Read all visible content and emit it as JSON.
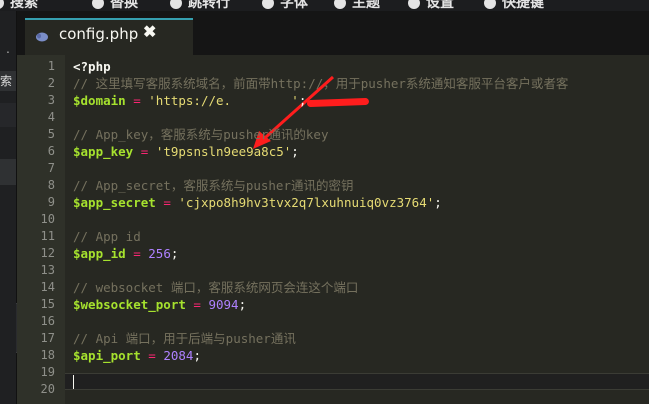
{
  "menubar": {
    "items": [
      {
        "label": "搜索",
        "icon": "search-icon"
      },
      {
        "label": "替换",
        "icon": "replace-icon"
      },
      {
        "label": "跳转行",
        "icon": "goto-icon"
      },
      {
        "label": "字体",
        "icon": "font-icon"
      },
      {
        "label": "主题",
        "icon": "theme-icon"
      },
      {
        "label": "设置",
        "icon": "gear-icon"
      },
      {
        "label": "快捷键",
        "icon": "keyboard-icon"
      }
    ]
  },
  "sidebar": {
    "search_label": "索",
    "collapse_glyph": "‹"
  },
  "tab": {
    "label": "config.php",
    "close": "✖",
    "icon": "php-elephant-icon"
  },
  "editor": {
    "lines": [
      {
        "n": "1",
        "tokens": [
          {
            "c": "tag",
            "t": "<?php"
          }
        ]
      },
      {
        "n": "2",
        "tokens": [
          {
            "c": "cmt",
            "t": "// 这里填写客服系统域名，前面带http://，用于pusher系统通知客服平台客户或者客"
          }
        ]
      },
      {
        "n": "3",
        "tokens": [
          {
            "c": "var",
            "t": "$domain"
          },
          {
            "c": "pun",
            "t": " "
          },
          {
            "c": "op",
            "t": "="
          },
          {
            "c": "pun",
            "t": " "
          },
          {
            "c": "str",
            "t": "'https://e."
          },
          {
            "c": "pun",
            "t": "        "
          },
          {
            "c": "str",
            "t": "'"
          },
          {
            "c": "pun",
            "t": ";"
          }
        ]
      },
      {
        "n": "4",
        "tokens": []
      },
      {
        "n": "5",
        "tokens": [
          {
            "c": "cmt",
            "t": "// App_key，客服系统与pusher通讯的key"
          }
        ]
      },
      {
        "n": "6",
        "tokens": [
          {
            "c": "var",
            "t": "$app_key"
          },
          {
            "c": "pun",
            "t": " "
          },
          {
            "c": "op",
            "t": "="
          },
          {
            "c": "pun",
            "t": " "
          },
          {
            "c": "str",
            "t": "'t9psnsln9ee9a8c5'"
          },
          {
            "c": "pun",
            "t": ";"
          }
        ]
      },
      {
        "n": "7",
        "tokens": []
      },
      {
        "n": "8",
        "tokens": [
          {
            "c": "cmt",
            "t": "// App_secret，客服系统与pusher通讯的密钥"
          }
        ]
      },
      {
        "n": "9",
        "tokens": [
          {
            "c": "var",
            "t": "$app_secret"
          },
          {
            "c": "pun",
            "t": " "
          },
          {
            "c": "op",
            "t": "="
          },
          {
            "c": "pun",
            "t": " "
          },
          {
            "c": "str",
            "t": "'cjxpo8h9hv3tvx2q7lxuhnuiq0vz3764'"
          },
          {
            "c": "pun",
            "t": ";"
          }
        ]
      },
      {
        "n": "10",
        "tokens": []
      },
      {
        "n": "11",
        "tokens": [
          {
            "c": "cmt",
            "t": "// App id"
          }
        ]
      },
      {
        "n": "12",
        "tokens": [
          {
            "c": "var",
            "t": "$app_id"
          },
          {
            "c": "pun",
            "t": " "
          },
          {
            "c": "op",
            "t": "="
          },
          {
            "c": "pun",
            "t": " "
          },
          {
            "c": "num",
            "t": "256"
          },
          {
            "c": "pun",
            "t": ";"
          }
        ]
      },
      {
        "n": "13",
        "tokens": []
      },
      {
        "n": "14",
        "tokens": [
          {
            "c": "cmt",
            "t": "// websocket 端口，客服系统网页会连这个端口"
          }
        ]
      },
      {
        "n": "15",
        "tokens": [
          {
            "c": "var",
            "t": "$websocket_port"
          },
          {
            "c": "pun",
            "t": " "
          },
          {
            "c": "op",
            "t": "="
          },
          {
            "c": "pun",
            "t": " "
          },
          {
            "c": "num",
            "t": "9094"
          },
          {
            "c": "pun",
            "t": ";"
          }
        ]
      },
      {
        "n": "16",
        "tokens": []
      },
      {
        "n": "17",
        "tokens": [
          {
            "c": "cmt",
            "t": "// Api 端口，用于后端与pusher通讯"
          }
        ]
      },
      {
        "n": "18",
        "tokens": [
          {
            "c": "var",
            "t": "$api_port"
          },
          {
            "c": "pun",
            "t": " "
          },
          {
            "c": "op",
            "t": "="
          },
          {
            "c": "pun",
            "t": " "
          },
          {
            "c": "num",
            "t": "2084"
          },
          {
            "c": "pun",
            "t": ";"
          }
        ]
      },
      {
        "n": "19",
        "tokens": []
      },
      {
        "n": "20",
        "tokens": []
      }
    ],
    "active_line": "20"
  },
  "colors": {
    "background": "#272822",
    "comment": "#75715e",
    "variable": "#a6e22e",
    "operator": "#f92672",
    "string": "#e6db74",
    "number": "#ae81ff",
    "annotation_red": "#ff1d1d",
    "tab_accent": "#36a0b0"
  }
}
